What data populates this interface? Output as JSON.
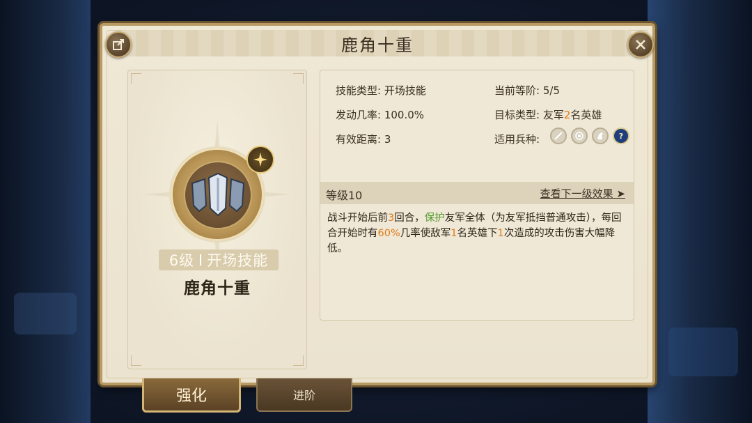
{
  "dialog": {
    "title": "鹿角十重"
  },
  "skill": {
    "level": "6级",
    "type": "开场技能",
    "name": "鹿角十重"
  },
  "attributes": {
    "skill_type_label": "技能类型:",
    "skill_type_value": "开场技能",
    "current_rank_label": "当前等阶:",
    "current_rank_value": "5/5",
    "trigger_rate_label": "发动几率:",
    "trigger_rate_value": "100.0%",
    "target_type_label": "目标类型:",
    "target_type_prefix": "友军",
    "target_type_count": "2",
    "target_type_suffix": "名英雄",
    "range_label": "有效距离:",
    "range_value": "3",
    "unit_types_label": "适用兵种:"
  },
  "unit_types": [
    {
      "icon": "sword-icon",
      "active": false
    },
    {
      "icon": "target-icon",
      "active": false
    },
    {
      "icon": "horse-icon",
      "active": false
    },
    {
      "icon": "question-icon",
      "symbol": "?",
      "active": true
    }
  ],
  "level_row": {
    "label": "等级10",
    "next_link": "查看下一级效果"
  },
  "description": {
    "p1": "战斗开始后前",
    "n1": "3",
    "p2": "回合，",
    "kw": "保护",
    "p3": "友军全体（为友军抵挡普通攻击），每回合开始时有",
    "n2": "60%",
    "p4": "几率使敌军",
    "n3": "1",
    "p5": "名英雄下",
    "n4": "1",
    "p6": "次造成的攻击伤害大幅降低。"
  },
  "tabs": [
    {
      "label": "强化",
      "active": true
    },
    {
      "label": "进阶",
      "active": false
    }
  ],
  "colors": {
    "highlight": "#e07a1a",
    "keyword": "#4f9a2a",
    "panel_bg": "#ebe3cf",
    "border_gold": "#b89a63"
  }
}
